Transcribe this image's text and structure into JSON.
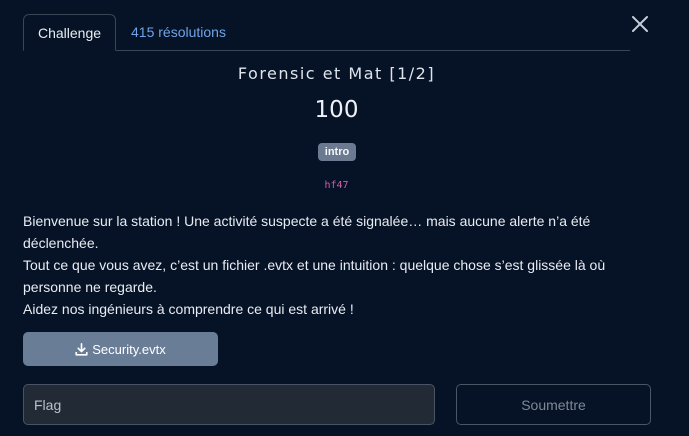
{
  "tabs": {
    "challenge_label": "Challenge",
    "solves_label": "415 résolutions"
  },
  "challenge": {
    "title": "Forensic et Mat [1/2]",
    "points": "100",
    "tag": "intro",
    "author": "hf47",
    "description": [
      "Bienvenue sur la station ! Une activité suspecte a été signalée… mais aucune alerte n’a été déclenchée.",
      "Tout ce que vous avez, c’est un fichier .evtx et une intuition : quelque chose s’est glissée là où personne ne regarde.",
      "Aidez nos ingénieurs à comprendre ce qui est arrivé !"
    ]
  },
  "attachment": {
    "file_name": "Security.evtx",
    "icon": "download-icon"
  },
  "flag_form": {
    "placeholder": "Flag",
    "value": "",
    "submit_label": "Soumettre"
  },
  "icons": {
    "close": "close-icon"
  },
  "colors": {
    "background": "#061225",
    "link": "#6fa4e8",
    "tag_bg": "#6b7a90",
    "author": "#d35fa8",
    "button_bg": "#6a7d97"
  }
}
